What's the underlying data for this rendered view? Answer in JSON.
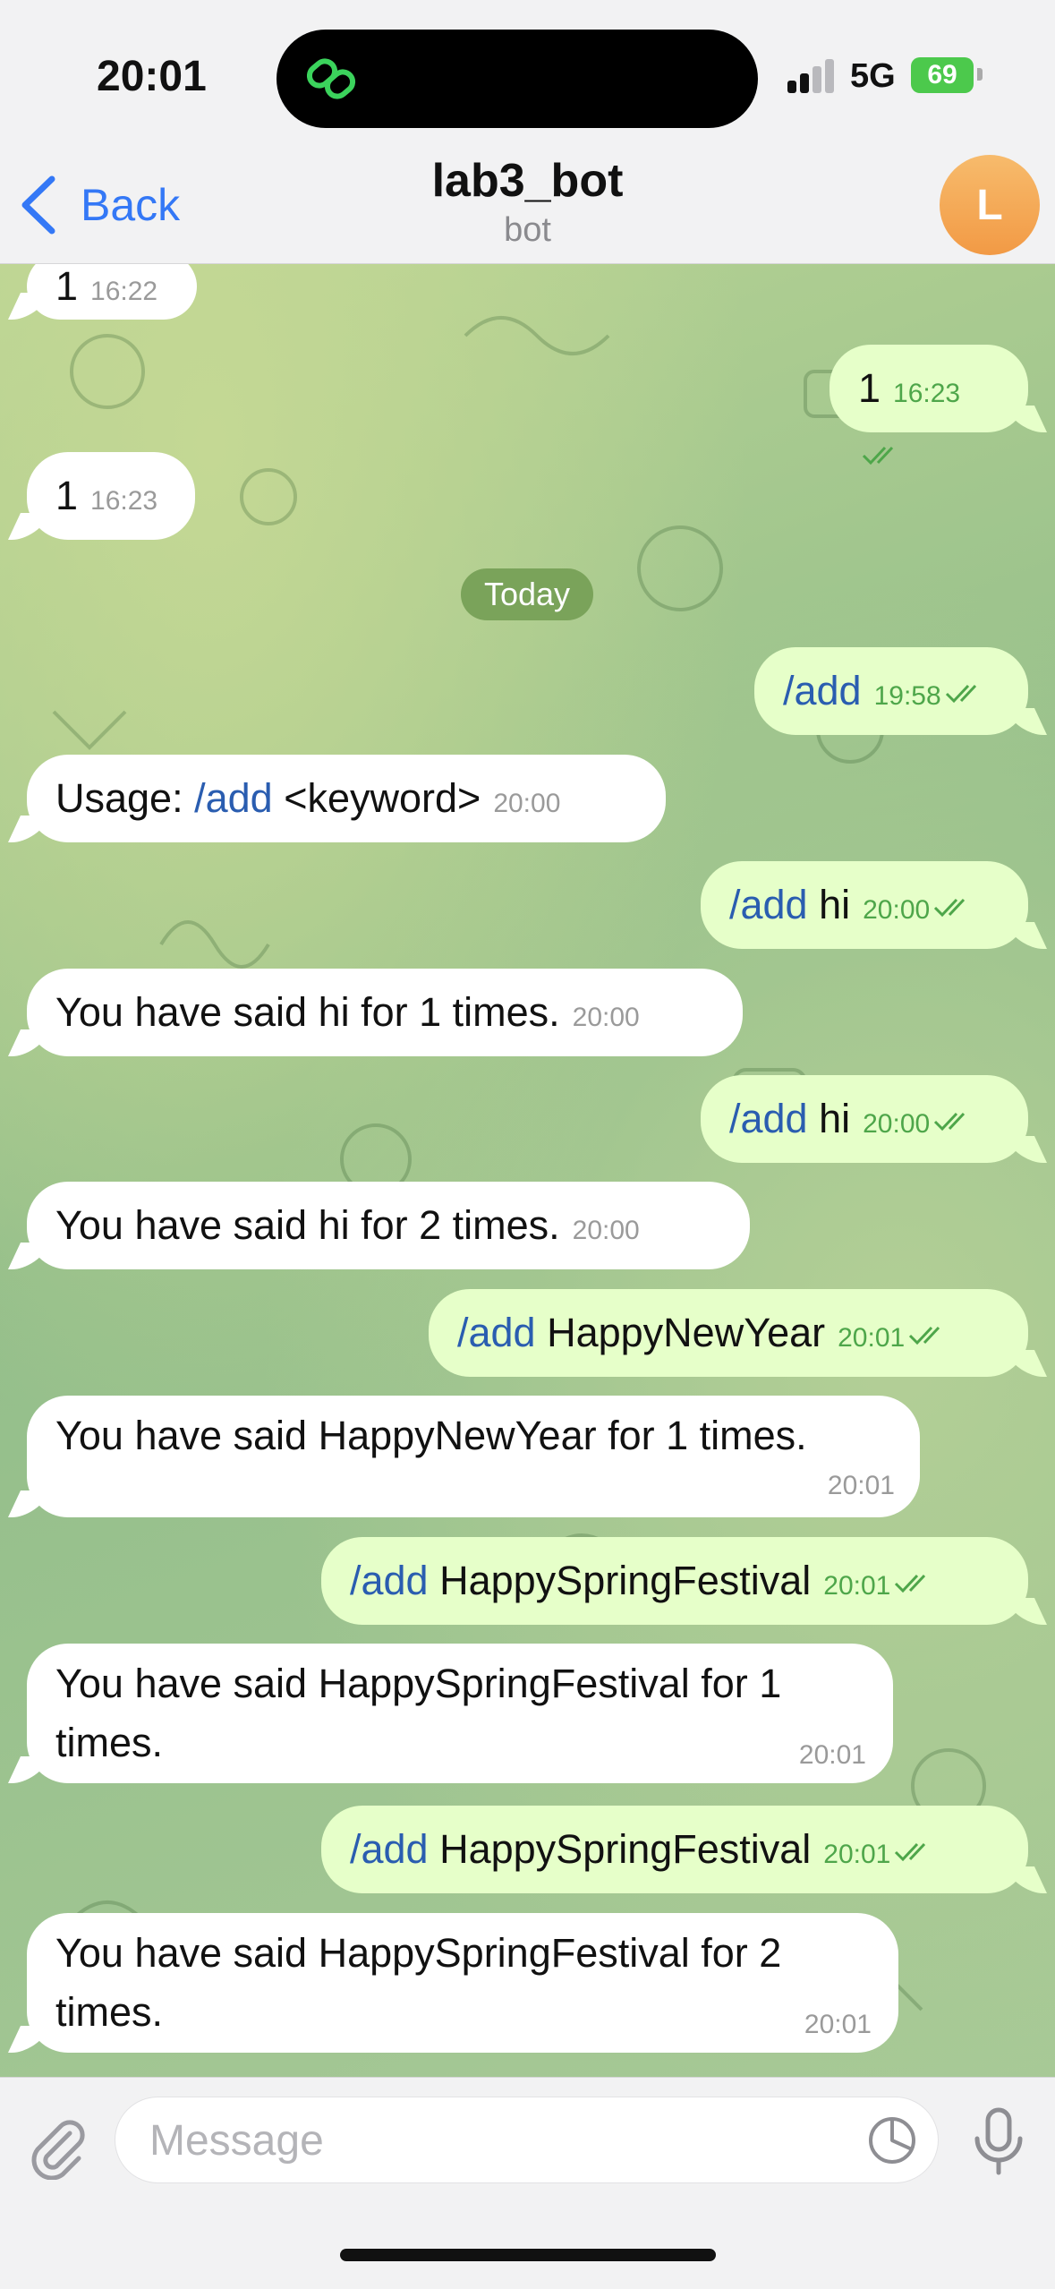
{
  "status_bar": {
    "time": "20:01",
    "network": "5G",
    "battery": "69"
  },
  "header": {
    "back_label": "Back",
    "title": "lab3_bot",
    "subtitle": "bot",
    "avatar_initial": "L"
  },
  "date_separator": "Today",
  "messages": [
    {
      "dir": "in",
      "cmd": "",
      "text": "1",
      "time": "16:22"
    },
    {
      "dir": "out",
      "cmd": "",
      "text": "1",
      "time": "16:23"
    },
    {
      "dir": "in",
      "cmd": "",
      "text": "1",
      "time": "16:23"
    },
    {
      "dir": "out",
      "cmd": "/add",
      "text": "",
      "time": "19:58"
    },
    {
      "dir": "in",
      "pre": "Usage: ",
      "cmd": "/add",
      "text": " <keyword>",
      "time": "20:00"
    },
    {
      "dir": "out",
      "cmd": "/add",
      "text": " hi",
      "time": "20:00"
    },
    {
      "dir": "in",
      "cmd": "",
      "text": "You have said hi for 1 times.",
      "time": "20:00"
    },
    {
      "dir": "out",
      "cmd": "/add",
      "text": " hi",
      "time": "20:00"
    },
    {
      "dir": "in",
      "cmd": "",
      "text": "You have said hi for 2 times.",
      "time": "20:00"
    },
    {
      "dir": "out",
      "cmd": "/add",
      "text": " HappyNewYear",
      "time": "20:01"
    },
    {
      "dir": "in",
      "cmd": "",
      "text": "You have said HappyNewYear for 1 times.",
      "time": "20:01"
    },
    {
      "dir": "out",
      "cmd": "/add",
      "text": " HappySpringFestival",
      "time": "20:01"
    },
    {
      "dir": "in",
      "cmd": "",
      "text": "You have said HappySpringFestival for 1\ntimes.",
      "time": "20:01"
    },
    {
      "dir": "out",
      "cmd": "/add",
      "text": " HappySpringFestival",
      "time": "20:01"
    },
    {
      "dir": "in",
      "cmd": "",
      "text": "You have said HappySpringFestival for 2\ntimes.",
      "time": "20:01"
    }
  ],
  "input": {
    "placeholder": "Message"
  },
  "colors": {
    "accent": "#3478f6",
    "outgoing_bubble": "#e6ffc9",
    "incoming_bubble": "#ffffff",
    "date_pill": "#7aa35a"
  }
}
